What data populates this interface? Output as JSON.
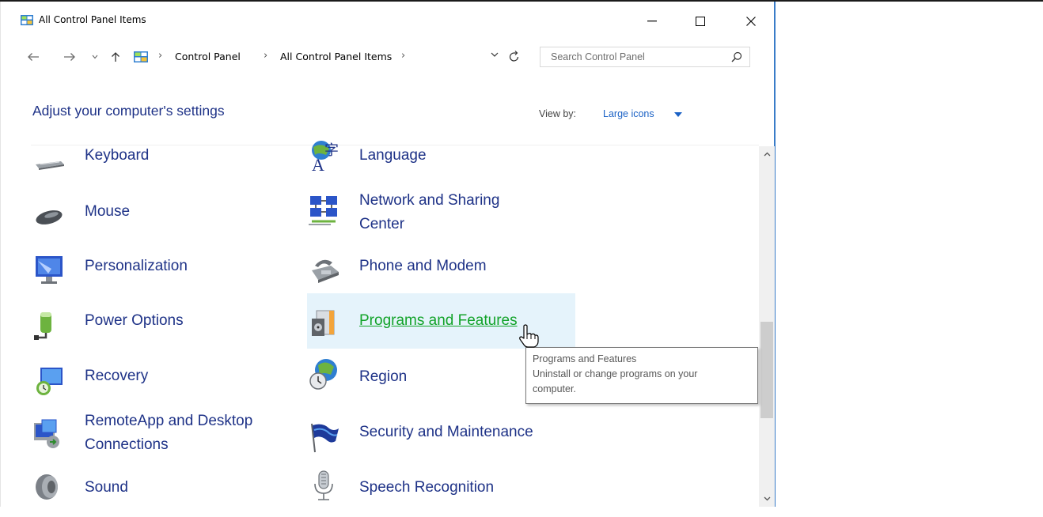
{
  "window": {
    "title": "All Control Panel Items",
    "controls": {
      "minimize": "—",
      "maximize": "☐",
      "close": "✕"
    }
  },
  "address": {
    "breadcrumbs": [
      "Control Panel",
      "All Control Panel Items"
    ],
    "search_placeholder": "Search Control Panel"
  },
  "header": {
    "heading": "Adjust your computer's settings",
    "view_by_label": "View by:",
    "view_by_value": "Large icons"
  },
  "items_left": [
    {
      "label": "Keyboard",
      "icon": "keyboard-icon"
    },
    {
      "label": "Mouse",
      "icon": "mouse-icon"
    },
    {
      "label": "Personalization",
      "icon": "personalization-icon"
    },
    {
      "label": "Power Options",
      "icon": "power-options-icon"
    },
    {
      "label": "Recovery",
      "icon": "recovery-icon"
    },
    {
      "label_line1": "RemoteApp and Desktop",
      "label_line2": "Connections",
      "icon": "remoteapp-icon"
    },
    {
      "label": "Sound",
      "icon": "sound-icon"
    }
  ],
  "items_right": [
    {
      "label": "Language",
      "icon": "language-icon"
    },
    {
      "label_line1": "Network and Sharing",
      "label_line2": "Center",
      "icon": "network-icon"
    },
    {
      "label": "Phone and Modem",
      "icon": "phone-modem-icon"
    },
    {
      "label": "Programs and Features",
      "icon": "programs-features-icon",
      "hovered": true
    },
    {
      "label": "Region",
      "icon": "region-icon"
    },
    {
      "label": "Security and Maintenance",
      "icon": "security-flag-icon"
    },
    {
      "label": "Speech Recognition",
      "icon": "microphone-icon"
    }
  ],
  "tooltip": {
    "title": "Programs and Features",
    "line1": "Uninstall or change programs on your",
    "line2": "computer."
  },
  "colors": {
    "link": "#1e3287",
    "hover_link": "#12a329",
    "hover_bg": "#e5f3fb",
    "accent": "#1a61c5"
  }
}
